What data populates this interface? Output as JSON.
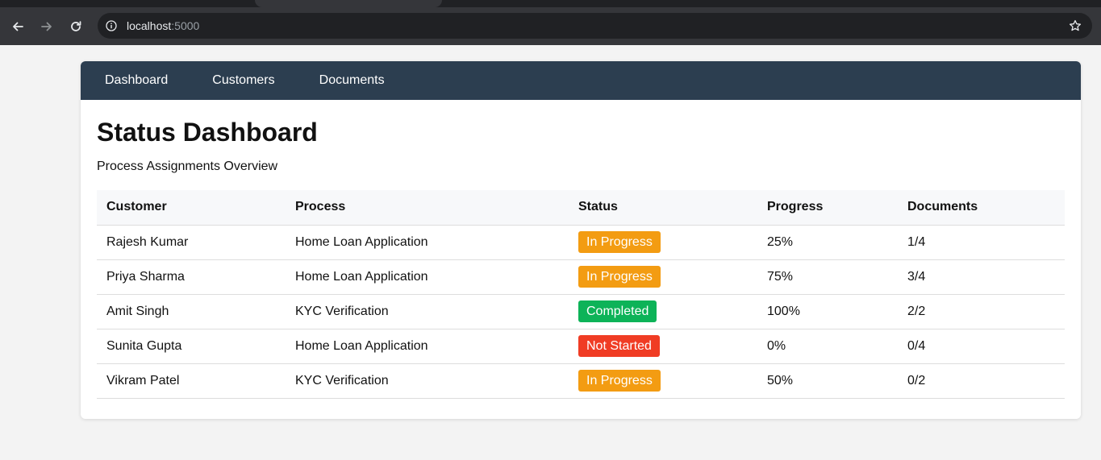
{
  "browser": {
    "url_host": "localhost",
    "url_port": ":5000",
    "icons": {
      "back": "arrow-left-icon",
      "forward": "arrow-right-icon",
      "reload": "reload-icon",
      "site_info": "info-icon",
      "bookmark": "star-icon"
    }
  },
  "nav": {
    "items": [
      {
        "label": "Dashboard"
      },
      {
        "label": "Customers"
      },
      {
        "label": "Documents"
      }
    ]
  },
  "page": {
    "title": "Status Dashboard",
    "subtitle": "Process Assignments Overview"
  },
  "table": {
    "headers": [
      "Customer",
      "Process",
      "Status",
      "Progress",
      "Documents"
    ],
    "rows": [
      {
        "customer": "Rajesh Kumar",
        "process": "Home Loan Application",
        "status": "In Progress",
        "status_color": "#f39c12",
        "progress": "25%",
        "documents": "1/4"
      },
      {
        "customer": "Priya Sharma",
        "process": "Home Loan Application",
        "status": "In Progress",
        "status_color": "#f39c12",
        "progress": "75%",
        "documents": "3/4"
      },
      {
        "customer": "Amit Singh",
        "process": "KYC Verification",
        "status": "Completed",
        "status_color": "#0db358",
        "progress": "100%",
        "documents": "2/2"
      },
      {
        "customer": "Sunita Gupta",
        "process": "Home Loan Application",
        "status": "Not Started",
        "status_color": "#f03c24",
        "progress": "0%",
        "documents": "0/4"
      },
      {
        "customer": "Vikram Patel",
        "process": "KYC Verification",
        "status": "In Progress",
        "status_color": "#f39c12",
        "progress": "50%",
        "documents": "0/2"
      }
    ]
  },
  "colors": {
    "nav_bg": "#2c3e50",
    "in_progress": "#f39c12",
    "completed": "#0db358",
    "not_started": "#f03c24"
  }
}
